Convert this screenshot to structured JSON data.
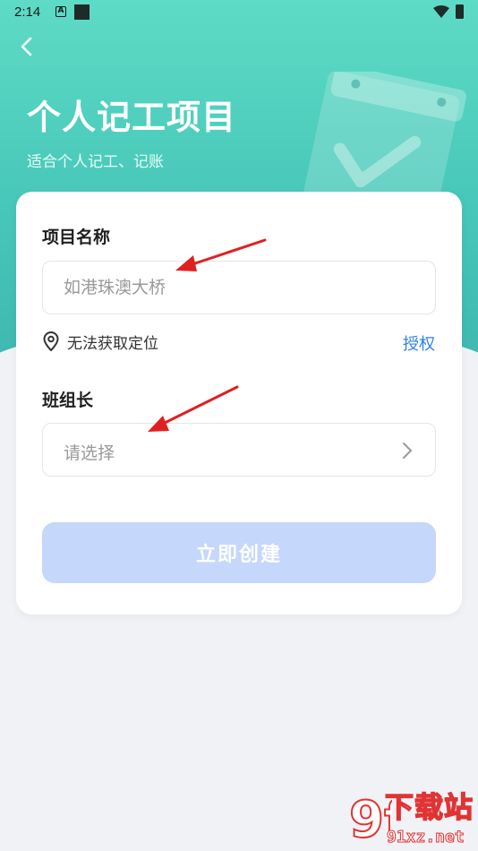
{
  "status_bar": {
    "time": "2:14",
    "notification_icon_letter": "A",
    "icons": [
      "a-notification-icon",
      "square-notification-icon",
      "wifi-icon",
      "battery-icon"
    ]
  },
  "header": {
    "back_icon": "chevron-left-icon",
    "title": "个人记工项目",
    "subtitle": "适合个人记工、记账"
  },
  "form": {
    "project_name": {
      "label": "项目名称",
      "placeholder": "如港珠澳大桥",
      "value": ""
    },
    "location": {
      "icon": "location-pin-icon",
      "status_text": "无法获取定位",
      "authorize_label": "授权"
    },
    "team_leader": {
      "label": "班组长",
      "placeholder": "请选择",
      "chevron_icon": "chevron-right-icon"
    },
    "submit_label": "立即创建"
  },
  "watermark": {
    "logo_text": "9f",
    "main_text": "下载站",
    "url": "91xz.net"
  },
  "colors": {
    "header_gradient_top": "#5edbc6",
    "header_gradient_bottom": "#3eb7b0",
    "page_background": "#f1f2f6",
    "link_blue": "#2f80ed",
    "button_disabled": "#c5d7fb",
    "annotation_arrow": "#e02020",
    "watermark_red": "#e03434"
  }
}
